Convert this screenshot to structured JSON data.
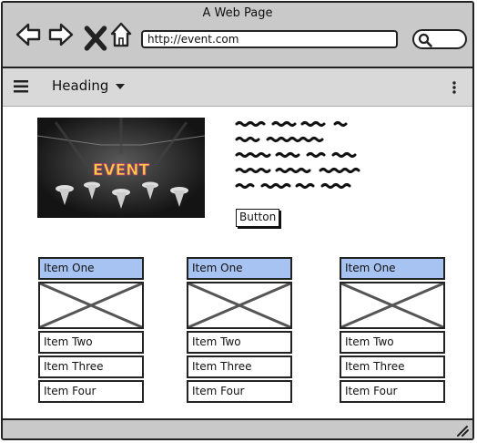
{
  "window": {
    "title": "A Web Page"
  },
  "toolbar": {
    "back_icon": "back-arrow-icon",
    "forward_icon": "forward-arrow-icon",
    "close_icon": "close-x-icon",
    "home_icon": "home-icon",
    "url": "http://event.com",
    "search_icon": "search-icon"
  },
  "appbar": {
    "menu_icon": "hamburger-menu-icon",
    "heading": "Heading",
    "dropdown_icon": "caret-down-icon",
    "more_icon": "kebab-menu-icon"
  },
  "hero": {
    "image_text": "EVENT"
  },
  "content": {
    "button_label": "Button"
  },
  "cards": [
    {
      "items": [
        "Item One",
        "Item Two",
        "Item Three",
        "Item Four"
      ]
    },
    {
      "items": [
        "Item One",
        "Item Two",
        "Item Three",
        "Item Four"
      ]
    },
    {
      "items": [
        "Item One",
        "Item Two",
        "Item Three",
        "Item Four"
      ]
    }
  ],
  "colors": {
    "chrome": "#c9c9c9",
    "appbar": "#d9d9d9",
    "selected_item": "#a7c3f2"
  }
}
